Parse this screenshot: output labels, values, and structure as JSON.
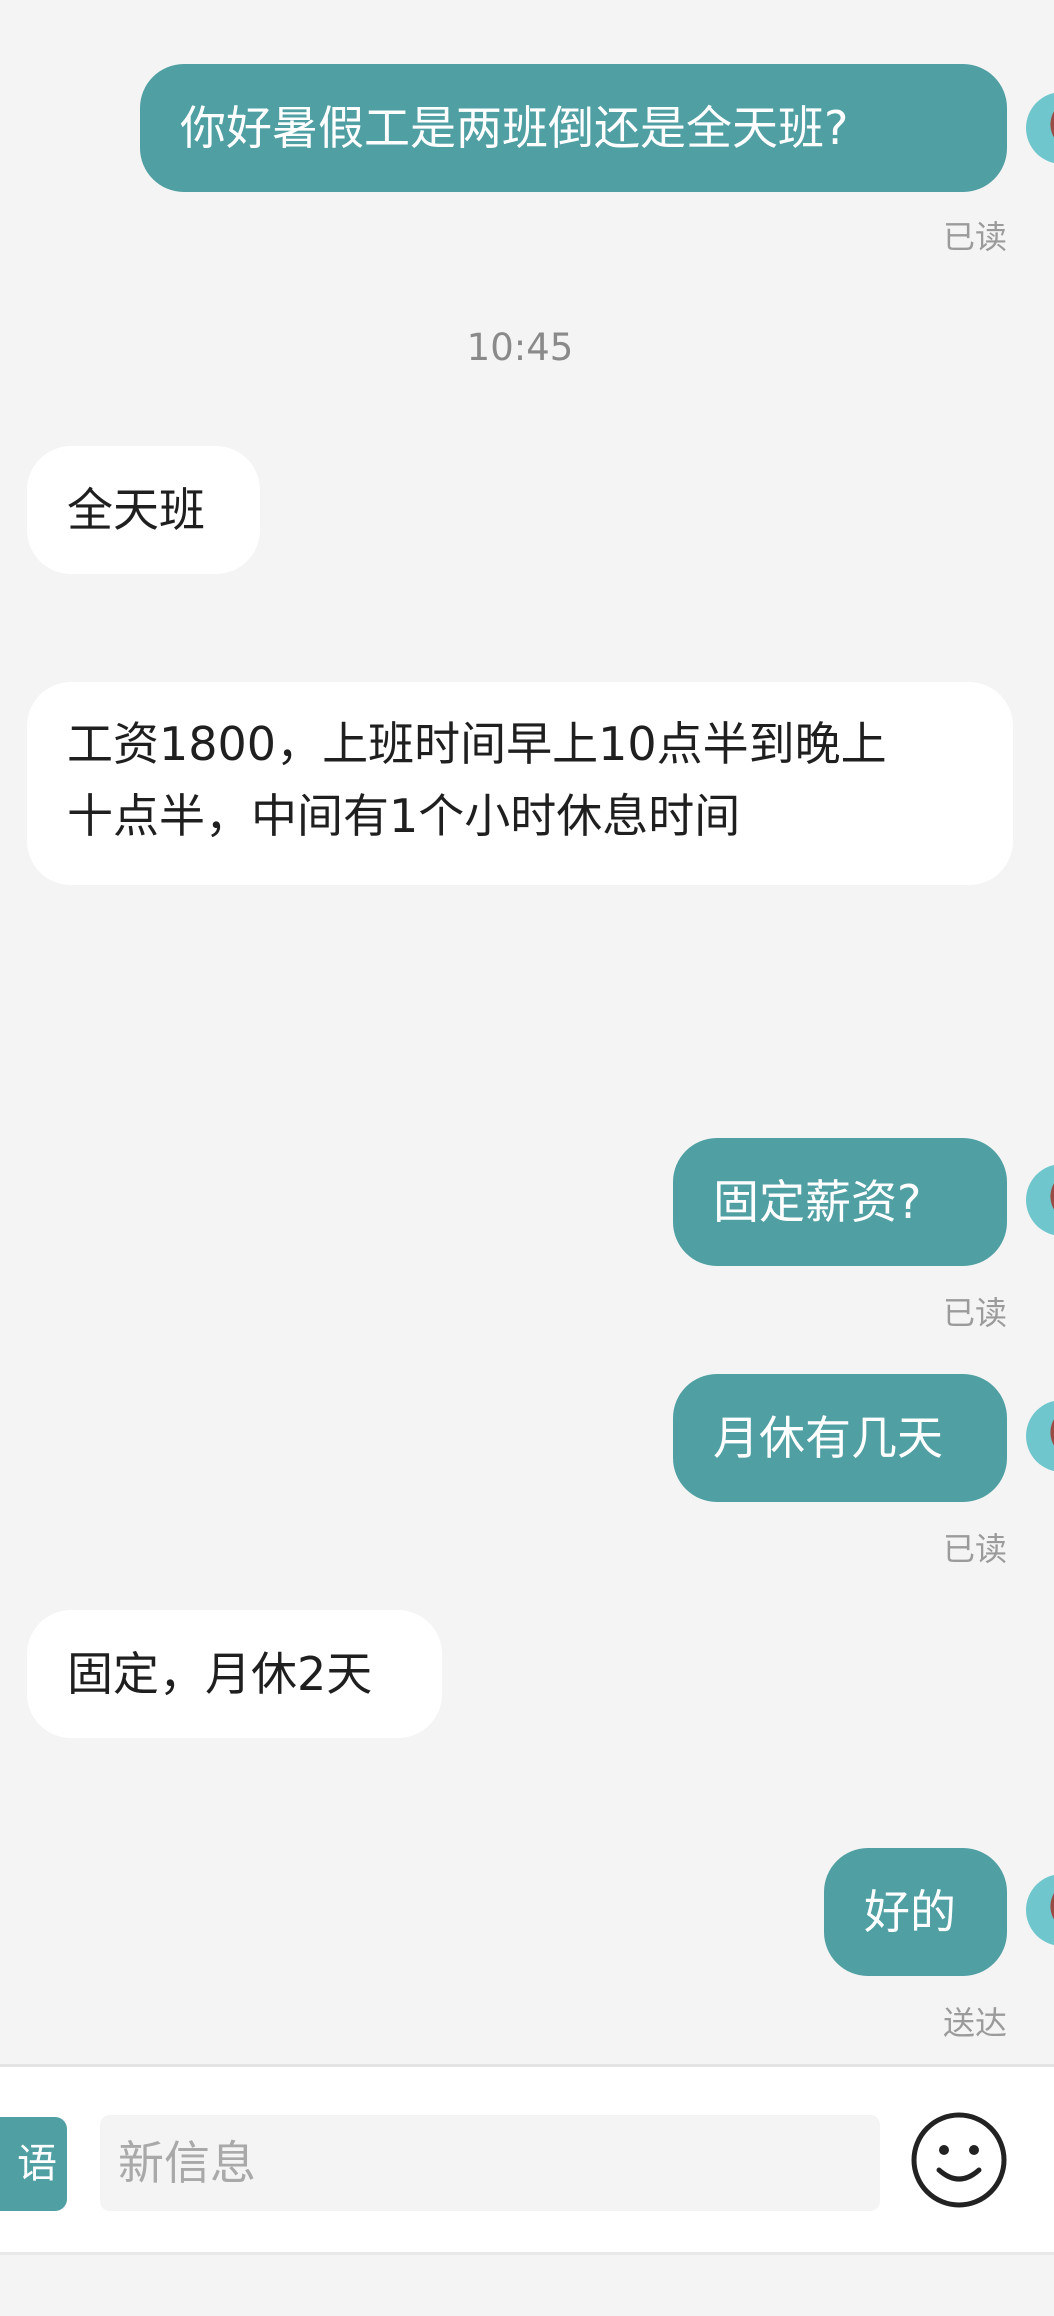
{
  "messages": [
    {
      "side": "out",
      "text": "你好暑假工是两班倒还是全天班?",
      "status": "已读"
    },
    {
      "timestamp": "10:45"
    },
    {
      "side": "in",
      "text": "全天班"
    },
    {
      "side": "in",
      "lines": [
        "工资1800，上班时间早上10点半到晚上",
        "十点半，中间有1个小时休息时间"
      ]
    },
    {
      "side": "out",
      "text": "固定薪资?",
      "status": "已读"
    },
    {
      "side": "out",
      "text": "月休有几天",
      "status": "已读"
    },
    {
      "side": "in",
      "text": "固定，月休2天"
    },
    {
      "side": "out",
      "text": "好的",
      "status": "送达"
    }
  ],
  "input_bar": {
    "phrase_button_label": "语",
    "placeholder": "新信息",
    "emoji_icon": "smiley-face-icon"
  },
  "colors": {
    "outgoing_bubble": "#4f9fa3",
    "incoming_bubble": "#ffffff",
    "background": "#f4f4f4"
  }
}
